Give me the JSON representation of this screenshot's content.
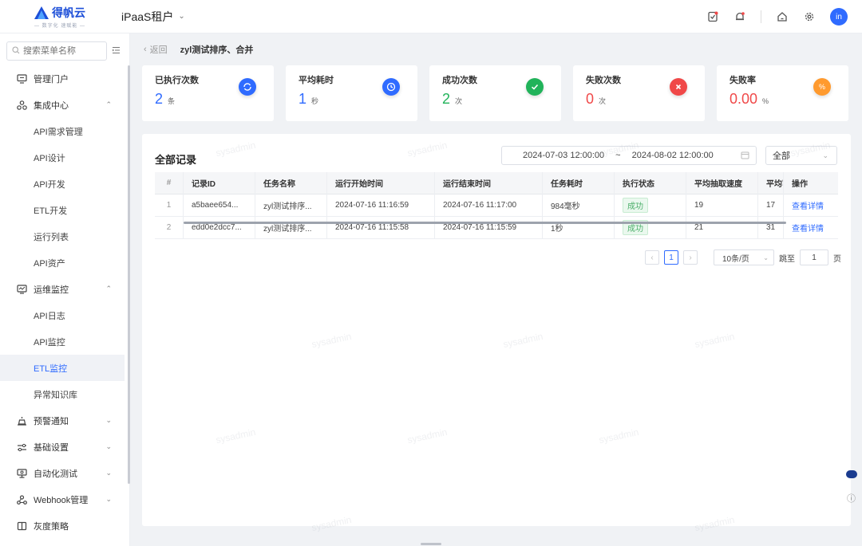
{
  "brand": {
    "name": "得帆云",
    "tagline": "— 数字化 速赋能 —"
  },
  "header": {
    "tenant": "iPaaS租户",
    "avatar_text": "in",
    "accent": "#2f6bff"
  },
  "sidebar": {
    "search_placeholder": "搜索菜单名称",
    "items": [
      {
        "label": "管理门户",
        "icon": "monitor-icon"
      },
      {
        "label": "集成中心",
        "icon": "cluster-icon",
        "expanded": true
      },
      {
        "label": "API需求管理"
      },
      {
        "label": "API设计"
      },
      {
        "label": "API开发"
      },
      {
        "label": "ETL开发"
      },
      {
        "label": "运行列表"
      },
      {
        "label": "API资产"
      },
      {
        "label": "运维监控",
        "icon": "monitor-chart-icon",
        "expanded": true
      },
      {
        "label": "API日志"
      },
      {
        "label": "API监控"
      },
      {
        "label": "ETL监控",
        "active": true
      },
      {
        "label": "异常知识库"
      },
      {
        "label": "预警通知",
        "icon": "alert-icon"
      },
      {
        "label": "基础设置",
        "icon": "settings-sliders-icon"
      },
      {
        "label": "自动化测试",
        "icon": "test-icon"
      },
      {
        "label": "Webhook管理",
        "icon": "webhook-icon"
      },
      {
        "label": "灰度策略",
        "icon": "gray-icon"
      }
    ]
  },
  "breadcrumb": {
    "back": "返回",
    "title": "zyl测试排序、合并"
  },
  "stats": [
    {
      "label": "已执行次数",
      "value": "2",
      "unit": "条",
      "color": "#2f6bff",
      "icon": "refresh-icon"
    },
    {
      "label": "平均耗时",
      "value": "1",
      "unit": "秒",
      "color": "#2f6bff",
      "icon": "clock-icon"
    },
    {
      "label": "成功次数",
      "value": "2",
      "unit": "次",
      "color": "#21b35a",
      "icon": "check-icon"
    },
    {
      "label": "失败次数",
      "value": "0",
      "unit": "次",
      "color": "#f04848",
      "icon": "close-icon"
    },
    {
      "label": "失败率",
      "value": "0.00",
      "unit": "%",
      "color": "#f04848",
      "icon": "percent-icon",
      "icon_color": "#ff9a2e"
    }
  ],
  "records": {
    "title": "全部记录",
    "date_start": "2024-07-03 12:00:00",
    "date_sep": "~",
    "date_end": "2024-08-02 12:00:00",
    "status_filter": "全部",
    "columns": [
      "#",
      "记录ID",
      "任务名称",
      "运行开始时间",
      "运行结束时间",
      "任务耗时",
      "执行状态",
      "平均抽取速度",
      "平均写",
      "操作"
    ],
    "rows": [
      {
        "no": "1",
        "id": "a5baee654...",
        "task": "zyl测试排序...",
        "start": "2024-07-16 11:16:59",
        "end": "2024-07-16 11:17:00",
        "duration": "984毫秒",
        "status": "成功",
        "read_speed": "19",
        "write_speed": "17",
        "action": "查看详情"
      },
      {
        "no": "2",
        "id": "edd0e2dcc7...",
        "task": "zyl测试排序...",
        "start": "2024-07-16 11:15:58",
        "end": "2024-07-16 11:15:59",
        "duration": "1秒",
        "status": "成功",
        "read_speed": "21",
        "write_speed": "31",
        "action": "查看详情"
      }
    ]
  },
  "pagination": {
    "current": "1",
    "page_size": "10条/页",
    "jump_label": "跳至",
    "jump_value": "1",
    "page_suffix": "页"
  },
  "watermark": "sysadmin"
}
